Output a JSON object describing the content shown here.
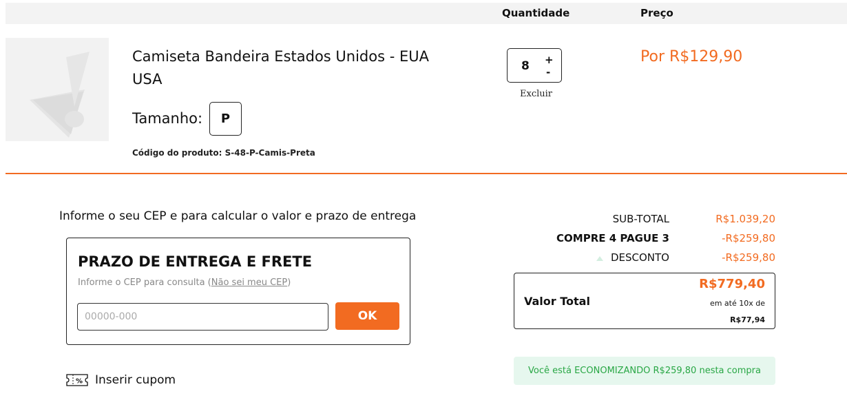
{
  "header": {
    "quantity_label": "Quantidade",
    "price_label": "Preço"
  },
  "product": {
    "name": "Camiseta Bandeira Estados Unidos - EUA USA",
    "size_label": "Tamanho:",
    "size_value": "P",
    "code_label": "Código do produto:",
    "code_value": "S-48-P-Camis-Preta",
    "quantity": "8",
    "plus": "+",
    "minus": "-",
    "remove_label": "Excluir",
    "price": "Por R$129,90",
    "image_icon": "image-placeholder-icon"
  },
  "shipping": {
    "intro": "Informe o seu CEP e para calcular o valor e prazo de entrega",
    "title": "PRAZO DE ENTREGA E FRETE",
    "hint": "Informe o CEP para consulta (",
    "hint_link": "Não sei meu CEP",
    "hint_end": ")",
    "input_placeholder": "00000-000",
    "ok_label": "OK"
  },
  "coupon": {
    "label": "Inserir cupom",
    "icon": "coupon-ticket-icon"
  },
  "summary": {
    "subtotal_label": "SUB-TOTAL",
    "subtotal_value": "R$1.039,20",
    "promo_label": "COMPRE 4 PAGUE 3",
    "promo_value": "-R$259,80",
    "discount_label": "DESCONTO",
    "discount_value": "-R$259,80",
    "total_label": "Valor Total",
    "total_value": "R$779,40",
    "installment_text": "em até 10x de",
    "installment_value": "R$77,94",
    "economy_text": "Você está ECONOMIZANDO R$259,80 nesta compra"
  },
  "colors": {
    "accent": "#f26b21",
    "success": "#29a745",
    "success_bg": "#e6f7ee"
  }
}
